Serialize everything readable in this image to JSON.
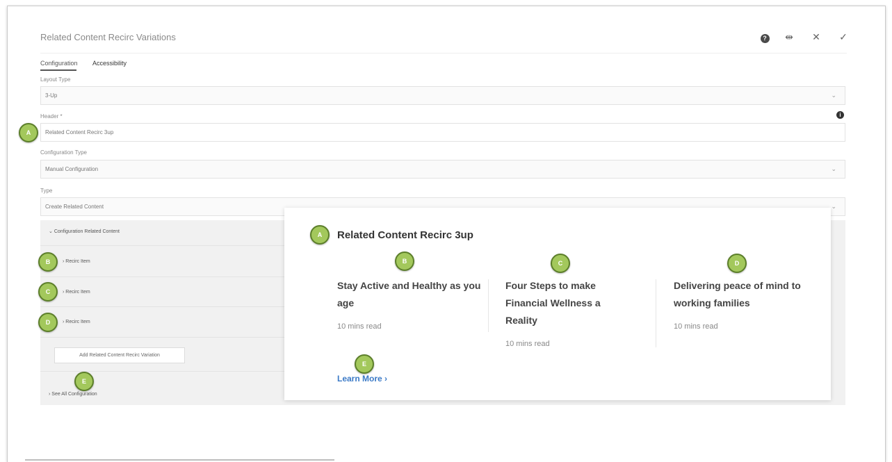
{
  "dialog": {
    "title": "Related Content Recirc Variations",
    "actions": {
      "help": "?",
      "fullscreen": "⇹",
      "close": "✕",
      "done": "✓"
    }
  },
  "tabs": [
    {
      "label": "Configuration",
      "active": true
    },
    {
      "label": "Accessibility",
      "active": false
    }
  ],
  "form": {
    "layout_type": {
      "label": "Layout Type",
      "value": "3-Up"
    },
    "header": {
      "label": "Header *",
      "value": "Related Content Recirc 3up"
    },
    "configuration_type": {
      "label": "Configuration Type",
      "value": "Manual Configuration"
    },
    "type": {
      "label": "Type",
      "value": "Create Related Content"
    }
  },
  "accordion": {
    "section_label": "Configuration Related Content",
    "items": [
      {
        "label": "Recirc Item"
      },
      {
        "label": "Recirc Item"
      },
      {
        "label": "Recirc Item"
      }
    ],
    "add_button": "Add Related Content Recirc Variation",
    "see_all": "See All Configuration"
  },
  "badges": {
    "a": "A",
    "b": "B",
    "c": "C",
    "d": "D",
    "e": "E"
  },
  "preview": {
    "title": "Related Content Recirc 3up",
    "cards": [
      {
        "title": "Stay Active and Healthy as you age",
        "meta": "10 mins read"
      },
      {
        "title": "Four Steps to make Financial Wellness a Reality",
        "meta": "10 mins read"
      },
      {
        "title": "Delivering peace of mind to working families",
        "meta": "10 mins read"
      }
    ],
    "learn_more": "Learn More ›"
  },
  "colors": {
    "badge_fill": "#a3c85c",
    "badge_border": "#5c7f2a",
    "link": "#3b7ac7",
    "panel_bg": "#f1f1f1"
  }
}
